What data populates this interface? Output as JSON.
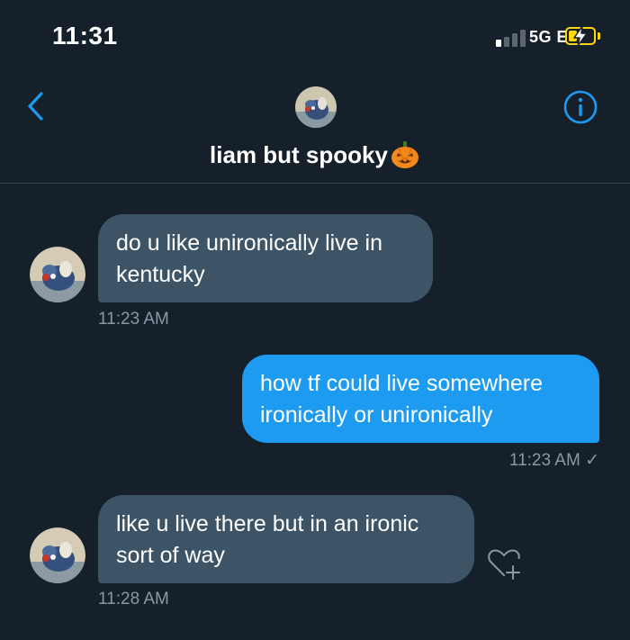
{
  "status_bar": {
    "time": "11:31",
    "network": "5G E",
    "signal_bars_filled": 1,
    "signal_bars_total": 4,
    "battery_level": 0.35,
    "charging": true
  },
  "header": {
    "title": "liam but spooky",
    "back_icon": "chevron-left-icon",
    "info_icon": "info-circle-icon",
    "accent_color": "#1d9bf0"
  },
  "messages": [
    {
      "direction": "received",
      "lines": [
        "do u like unironically live in",
        "kentucky"
      ],
      "timestamp": "11:23 AM"
    },
    {
      "direction": "sent",
      "lines": [
        "how tf could live somewhere",
        "ironically or unironically"
      ],
      "timestamp": "11:23 AM",
      "status": "✓"
    },
    {
      "direction": "received",
      "lines": [
        "like u live there but in an ironic",
        "sort of way"
      ],
      "timestamp": "11:28 AM"
    }
  ],
  "colors": {
    "background": "#15202b",
    "received_bubble": "#3d5466",
    "sent_bubble": "#1d9bf0",
    "meta_text": "#8899a6"
  }
}
